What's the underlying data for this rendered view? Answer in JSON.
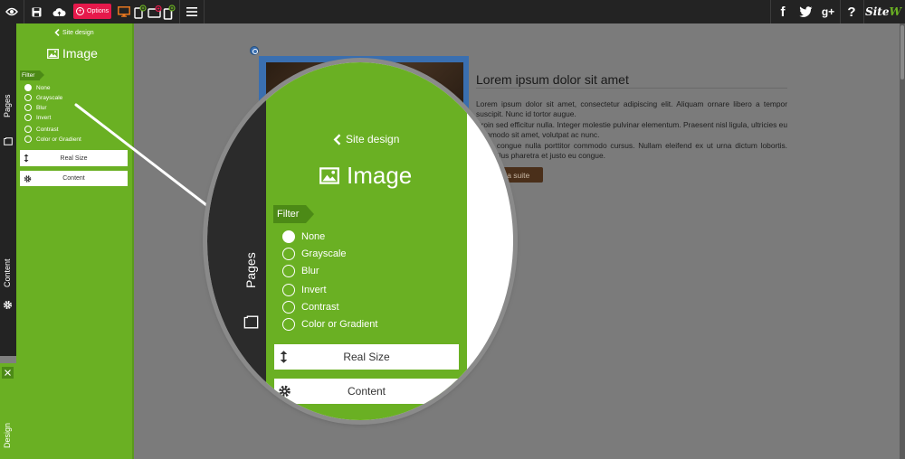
{
  "toolbar": {
    "options_label": "Options",
    "icons": [
      "eye-icon",
      "save-icon",
      "cloud-upload-icon",
      "desktop-icon",
      "tablet-landscape-icon",
      "tablet-portrait-icon",
      "mobile-icon",
      "menu-icon"
    ],
    "right_icons": [
      "facebook-icon",
      "twitter-icon",
      "google-plus-icon",
      "help-icon"
    ],
    "logo_part1": "Site",
    "logo_part2": "W",
    "social": {
      "facebook": "f",
      "gplus": "g+",
      "help": "?"
    }
  },
  "rail": {
    "pages_label": "Pages",
    "content_label": "Content",
    "design_label": "Design"
  },
  "panel": {
    "back_label": "Site design",
    "title": "Image",
    "filter_label": "Filter",
    "filters": [
      {
        "label": "None",
        "selected": true
      },
      {
        "label": "Grayscale",
        "selected": false
      },
      {
        "label": "Blur",
        "selected": false
      },
      {
        "label": "Invert",
        "selected": false
      },
      {
        "label": "Contrast",
        "selected": false
      },
      {
        "label": "Color or Gradient",
        "selected": false
      }
    ],
    "real_size_label": "Real Size",
    "content_label": "Content"
  },
  "article": {
    "title": "Lorem ipsum dolor sit amet",
    "body": "Lorem ipsum dolor sit amet, consectetur adipiscing elit. Aliquam ornare libero a tempor suscipit. Nunc id tortor augue.\nProin sed efficitur nulla. Integer molestie pulvinar elementum. Praesent nisl ligula, ultricies eu commodo sit amet, volutpat ac nunc.\nNulla congue nulla porttitor commodo cursus. Nullam eleifend ex ut urna dictum lobortis. Phasellus pharetra et justo eu congue.",
    "button_label": "Lire la suite"
  },
  "colors": {
    "green": "#6ab023",
    "dark": "#232323",
    "options_pink": "#e6194b",
    "accent_orange": "#e8771f"
  }
}
